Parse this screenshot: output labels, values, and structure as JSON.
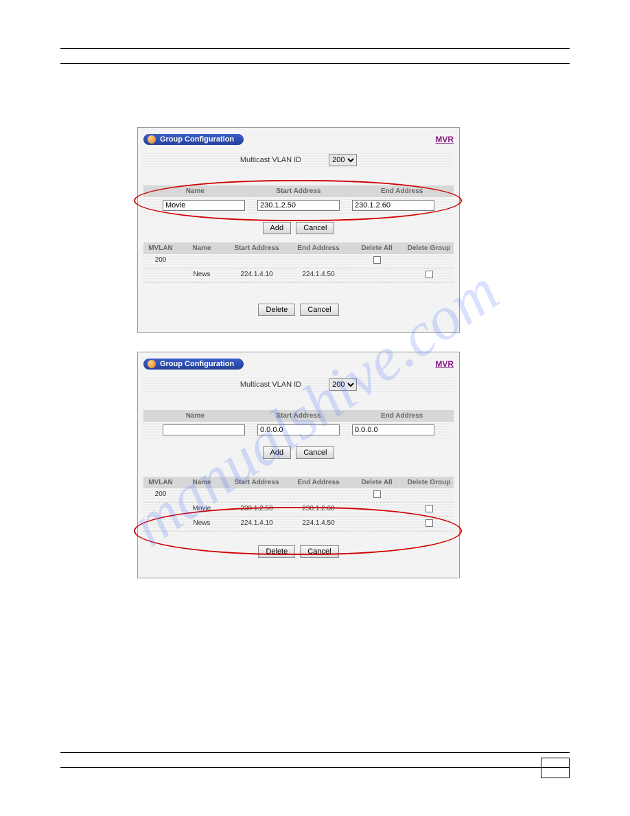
{
  "watermark": "manualshive.com",
  "panel_title": "Group Configuration",
  "mvr_label": "MVR",
  "vlan_label": "Multicast VLAN ID",
  "vlan_selected": "200",
  "vlan_options": [
    "200"
  ],
  "form_headers": {
    "name": "Name",
    "start": "Start Address",
    "end": "End Address"
  },
  "panel1_form": {
    "name": "Movie",
    "start": "230.1.2.50",
    "end": "230.1.2.60"
  },
  "panel2_form": {
    "name": "",
    "start": "0.0.0.0",
    "end": "0.0.0.0"
  },
  "buttons": {
    "add": "Add",
    "cancel": "Cancel",
    "delete": "Delete"
  },
  "table_headers": {
    "mvlan": "MVLAN",
    "name": "Name",
    "start": "Start Address",
    "end": "End Address",
    "delall": "Delete All",
    "delgrp": "Delete Group"
  },
  "panel1_rows": [
    {
      "mvlan": "200",
      "name": "",
      "start": "",
      "end": "",
      "delall": true,
      "delgrp": false
    },
    {
      "mvlan": "",
      "name": "News",
      "start": "224.1.4.10",
      "end": "224.1.4.50",
      "delall": false,
      "delgrp": true
    }
  ],
  "panel2_rows": [
    {
      "mvlan": "200",
      "name": "",
      "start": "",
      "end": "",
      "delall": true,
      "delgrp": false
    },
    {
      "mvlan": "",
      "name": "Movie",
      "start": "230.1.2.50",
      "end": "230.1.2.60",
      "delall": false,
      "delgrp": true
    },
    {
      "mvlan": "",
      "name": "News",
      "start": "224.1.4.10",
      "end": "224.1.4.50",
      "delall": false,
      "delgrp": true
    }
  ]
}
